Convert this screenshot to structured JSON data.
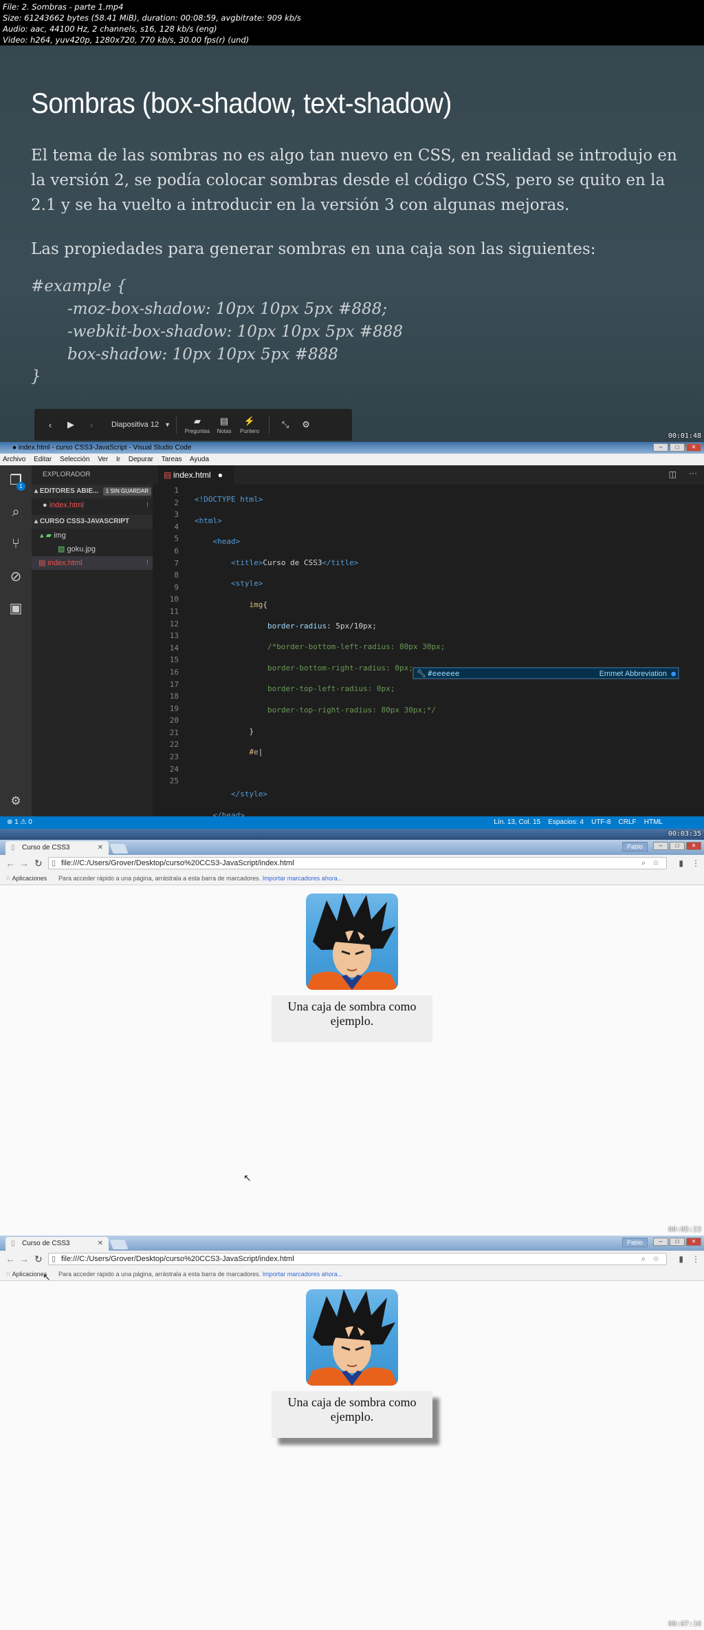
{
  "header": {
    "lines": [
      "File: 2. Sombras - parte 1.mp4",
      "Size: 61243662 bytes (58.41 MiB), duration: 00:08:59, avgbitrate: 909 kb/s",
      "Audio: aac, 44100 Hz, 2 channels, s16, 128 kb/s (eng)",
      "Video: h264, yuv420p, 1280x720, 770 kb/s, 30.00 fps(r) (und)"
    ]
  },
  "timestamps": [
    "00:01:48",
    "00:03:35",
    "00:05:23",
    "00:07:10"
  ],
  "slide": {
    "title": "Sombras (box-shadow, text-shadow)",
    "paragraph1": "El tema de las sombras no es algo tan nuevo en CSS, en realidad se introdujo en la versión 2, se podía colocar sombras desde el código CSS, pero se quito en la 2.1 y se ha vuelto a introducir en la versión 3 con algunas mejoras.",
    "paragraph2": "Las propiedades para generar sombras en una caja son las siguientes:",
    "code": [
      "#example {",
      "-moz-box-shadow: 10px 10px 5px #888;",
      "-webkit-box-shadow: 10px 10px 5px #888",
      "box-shadow: 10px 10px 5px #888",
      "}"
    ],
    "toolbar": {
      "slide_label": "Diapositiva 12",
      "preguntas": "Preguntas",
      "notas": "Notas",
      "puntero": "Puntero"
    }
  },
  "vscode": {
    "title": "● index.html - curso CSS3-JavaScript - Visual Studio Code",
    "menu": [
      "Archivo",
      "Editar",
      "Selección",
      "Ver",
      "Ir",
      "Depurar",
      "Tareas",
      "Ayuda"
    ],
    "explorer_label": "EXPLORADOR",
    "open_editors": "EDITORES ABIE...",
    "unsaved_badge": "1 SIN GUARDAR",
    "open_file": "index.html",
    "project": "CURSO CSS3-JAVASCRIPT",
    "folder": "img",
    "image_file": "goku.jpg",
    "project_file": "index.html",
    "tab_label": "index.html",
    "suggestion": "#eeeeee",
    "suggestion_type": "Emmet Abbreviation",
    "status_left": "⊗ 1 ⚠ 0",
    "status_right": "Lín. 13, Col. 15    Espacios: 4    UTF-8    CRLF    HTML",
    "activity_badge": "1"
  },
  "browser": {
    "tab_title": "Curso de CSS3",
    "url": "file:///C:/Users/Grover/Desktop/curso%20CCS3-JavaScript/index.html",
    "apps_label": "Aplicaciones",
    "bookmarks_hint": "Para acceder rápido a una página, arrástrala a esta barra de marcadores.",
    "bookmarks_link": "Importar marcadores ahora...",
    "user": "Pablo",
    "box_text": "Una caja de sombra como ejemplo."
  }
}
